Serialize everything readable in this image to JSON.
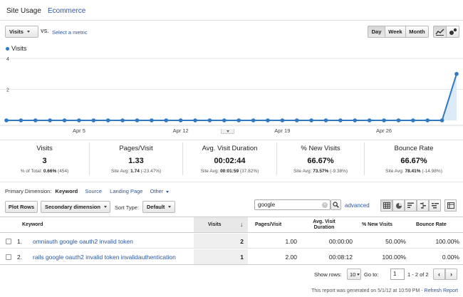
{
  "tabs": {
    "site_usage": "Site Usage",
    "ecommerce": "Ecommerce"
  },
  "toolbar": {
    "metric_select": "Visits",
    "vs": "VS.",
    "select_metric": "Select a metric",
    "day": "Day",
    "week": "Week",
    "month": "Month"
  },
  "chart_data": {
    "type": "line",
    "legend": "Visits",
    "y_ticks": [
      "4",
      "2"
    ],
    "ylim": [
      0,
      4
    ],
    "x_tick_labels": [
      "Apr 5",
      "Apr 12",
      "Apr 19",
      "Apr 26"
    ],
    "series": [
      {
        "name": "Visits",
        "color": "#2f78c2",
        "x": [
          "Mar 31",
          "Apr 1",
          "Apr 2",
          "Apr 3",
          "Apr 4",
          "Apr 5",
          "Apr 6",
          "Apr 7",
          "Apr 8",
          "Apr 9",
          "Apr 10",
          "Apr 11",
          "Apr 12",
          "Apr 13",
          "Apr 14",
          "Apr 15",
          "Apr 16",
          "Apr 17",
          "Apr 18",
          "Apr 19",
          "Apr 20",
          "Apr 21",
          "Apr 22",
          "Apr 23",
          "Apr 24",
          "Apr 25",
          "Apr 26",
          "Apr 27",
          "Apr 28",
          "Apr 29",
          "Apr 30",
          "May 1"
        ],
        "values": [
          0,
          0,
          0,
          0,
          0,
          0,
          0,
          0,
          0,
          0,
          0,
          0,
          0,
          0,
          0,
          0,
          0,
          0,
          0,
          0,
          0,
          0,
          0,
          0,
          0,
          0,
          0,
          0,
          0,
          0,
          0,
          3
        ]
      }
    ]
  },
  "metrics": [
    {
      "title": "Visits",
      "value": "3",
      "sub_prefix": "% of Total: ",
      "sub_bold": "0.66%",
      "sub_suffix": " (454)"
    },
    {
      "title": "Pages/Visit",
      "value": "1.33",
      "sub_prefix": "Site Avg: ",
      "sub_bold": "1.74",
      "sub_suffix": " (-23.47%)"
    },
    {
      "title": "Avg. Visit Duration",
      "value": "00:02:44",
      "sub_prefix": "Site Avg: ",
      "sub_bold": "00:01:59",
      "sub_suffix": " (37.82%)"
    },
    {
      "title": "% New Visits",
      "value": "66.67%",
      "sub_prefix": "Site Avg: ",
      "sub_bold": "73.57%",
      "sub_suffix": " (-9.38%)"
    },
    {
      "title": "Bounce Rate",
      "value": "66.67%",
      "sub_prefix": "Site Avg: ",
      "sub_bold": "78.41%",
      "sub_suffix": " (-14.98%)"
    }
  ],
  "dimension": {
    "label": "Primary Dimension:",
    "keyword": "Keyword",
    "source": "Source",
    "landing_page": "Landing Page",
    "other": "Other"
  },
  "controls": {
    "plot_rows": "Plot Rows",
    "secondary_dimension": "Secondary dimension",
    "sort_type_label": "Sort Type:",
    "sort_type_value": "Default",
    "search_value": "google",
    "advanced": "advanced"
  },
  "table": {
    "headers": {
      "keyword": "Keyword",
      "visits": "Visits",
      "pages_visit": "Pages/Visit",
      "avg_visit_duration": "Avg. Visit Duration",
      "new_visits": "% New Visits",
      "bounce_rate": "Bounce Rate"
    },
    "rows": [
      {
        "index": "1.",
        "keyword": "omniauth google oauth2 invalid token",
        "visits": "2",
        "pages_visit": "1.00",
        "duration": "00:00:00",
        "new_visits": "50.00%",
        "bounce_rate": "100.00%"
      },
      {
        "index": "2.",
        "keyword": "rails google oauth2 invalid token invalidauthentication",
        "visits": "1",
        "pages_visit": "2.00",
        "duration": "00:08:12",
        "new_visits": "100.00%",
        "bounce_rate": "0.00%"
      }
    ]
  },
  "pagination": {
    "show_rows_label": "Show rows:",
    "show_rows_value": "10",
    "go_to_label": "Go to:",
    "go_to_value": "1",
    "range": "1 - 2 of 2",
    "prev": "‹",
    "next": "›"
  },
  "footer": {
    "text": "This report was generated on 5/1/12 at 10:59 PM -",
    "refresh": "Refresh Report"
  }
}
